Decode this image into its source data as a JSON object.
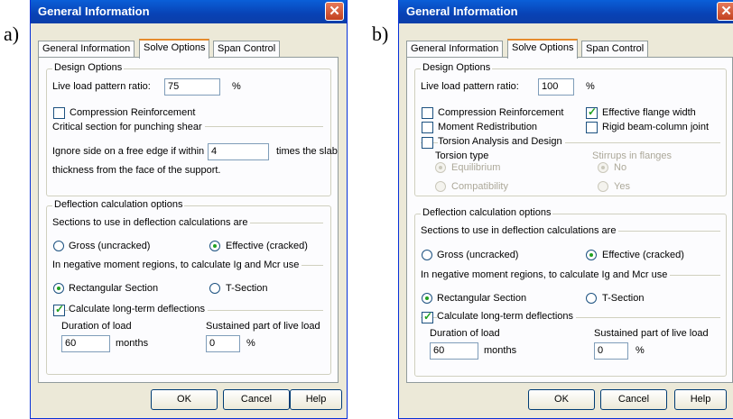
{
  "labels": {
    "a": "a)",
    "b": "b)"
  },
  "title": "General Information",
  "close": "✕",
  "tabs": [
    "General Information",
    "Solve Options",
    "Span Control"
  ],
  "buttons": {
    "ok": "OK",
    "cancel": "Cancel",
    "help": "Help"
  },
  "common": {
    "design_options": "Design Options",
    "live_load_label": "Live load pattern ratio:",
    "percent": "%",
    "compression": "Compression Reinforcement",
    "deflection_options": "Deflection calculation options",
    "sections_header": "Sections to use in deflection calculations are",
    "gross": "Gross (uncracked)",
    "effective": "Effective (cracked)",
    "negative_moment": "In negative moment regions, to calculate Ig and Mcr use",
    "rectangular": "Rectangular Section",
    "tsection": "T-Section",
    "long_term": "Calculate long-term deflections",
    "duration": "Duration of load",
    "months": "months",
    "sustained": "Sustained part of live load"
  },
  "a": {
    "live_load_value": "75",
    "critical_section": "Critical section for punching shear",
    "ignore_side": "Ignore side on a free edge if within",
    "ignore_value": "4",
    "times_slab": "times the slab",
    "thickness": "thickness from the face of the support.",
    "duration_value": "60",
    "sustained_value": "0"
  },
  "b": {
    "live_load_value": "100",
    "effective_flange": "Effective flange width",
    "moment_redistribution": "Moment Redistribution",
    "rigid_joint": "Rigid beam-column joint",
    "torsion": "Torsion Analysis and Design",
    "torsion_type": "Torsion type",
    "equilibrium": "Equilibrium",
    "compatibility": "Compatibility",
    "stirrups": "Stirrups in flanges",
    "no": "No",
    "yes": "Yes",
    "duration_value": "60",
    "sustained_value": "0"
  }
}
